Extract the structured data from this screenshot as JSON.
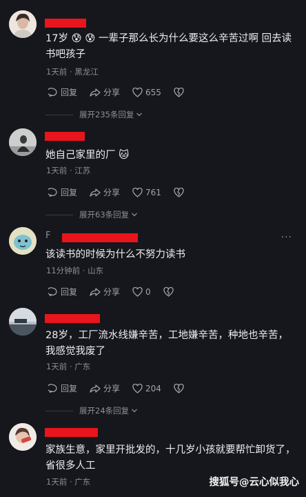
{
  "comments": [
    {
      "text": "17岁 😰 😰 一辈子那么长为什么要这么辛苦过啊 回去读书吧孩子",
      "meta": "1天前 · 黑龙江",
      "reply_label": "回复",
      "share_label": "分享",
      "likes": "655",
      "expand_label": "展开235条回复"
    },
    {
      "text": "她自己家里的厂 🐱",
      "meta": "1天前 · 江苏",
      "reply_label": "回复",
      "share_label": "分享",
      "likes": "761",
      "expand_label": "展开63条回复"
    },
    {
      "name_visible": "F",
      "text": "该读书的时候为什么不努力读书",
      "meta": "11分钟前 · 山东",
      "reply_label": "回复",
      "share_label": "分享",
      "likes": "0",
      "more_label": "···"
    },
    {
      "text": "28岁，工厂流水线嫌辛苦，工地嫌辛苦，种地也辛苦，我感觉我废了",
      "meta": "1天前 · 广东",
      "reply_label": "回复",
      "share_label": "分享",
      "likes": "204",
      "expand_label": "展开24条回复"
    },
    {
      "text": "家族生意，家里开批发的，十几岁小孩就要帮忙卸货了，省很多人工",
      "meta": "1天前 · 广东"
    }
  ],
  "watermark": "搜狐号@云心似我心",
  "colors": {
    "background": "#16171c",
    "redaction": "#e8151c",
    "meta": "#8c8e97"
  }
}
